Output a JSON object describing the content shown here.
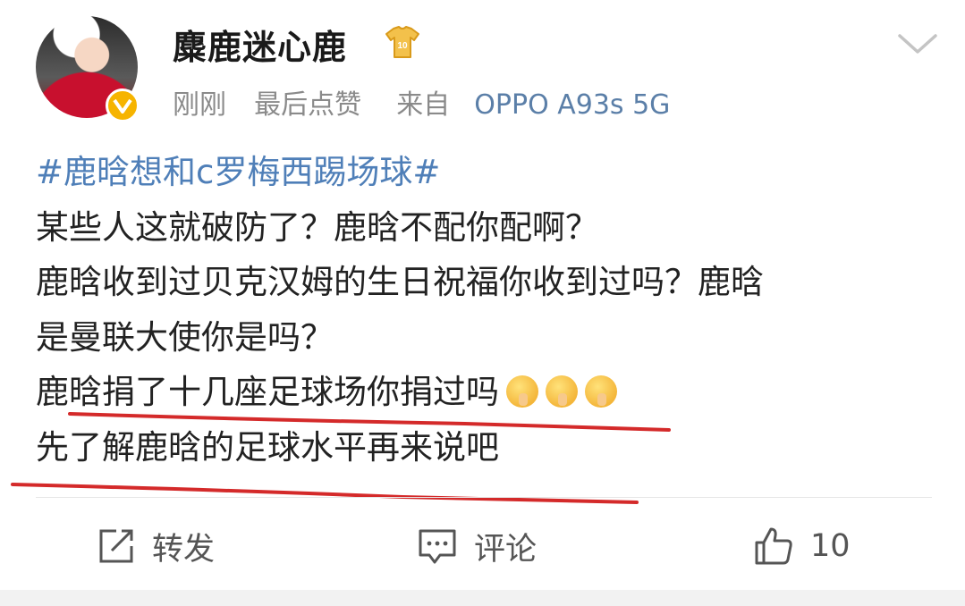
{
  "post": {
    "username": "麋鹿迷心鹿",
    "meta": {
      "time": "刚刚",
      "action": "最后点赞",
      "source_prefix": "来自",
      "device": "OPPO A93s 5G"
    },
    "content": {
      "hashtag": "#鹿晗想和c罗梅西踢场球#",
      "lines": [
        "某些人这就破防了？鹿晗不配你配啊？",
        "鹿晗收到过贝克汉姆的生日祝福你收到过吗？鹿晗",
        "是曼联大使你是吗？",
        "鹿晗捐了十几座足球场你捐过吗",
        "先了解鹿晗的足球水平再来说吧"
      ],
      "emojis": [
        "shush-emoji",
        "shush-emoji",
        "shush-emoji"
      ]
    },
    "actions": {
      "repost_label": "转发",
      "comment_label": "评论",
      "like_count": "10"
    },
    "colors": {
      "hashtag": "#4f7fb8",
      "device": "#5b7fa8",
      "verified_badge": "#f6b400",
      "annotation_underline": "#d42a2a"
    }
  }
}
